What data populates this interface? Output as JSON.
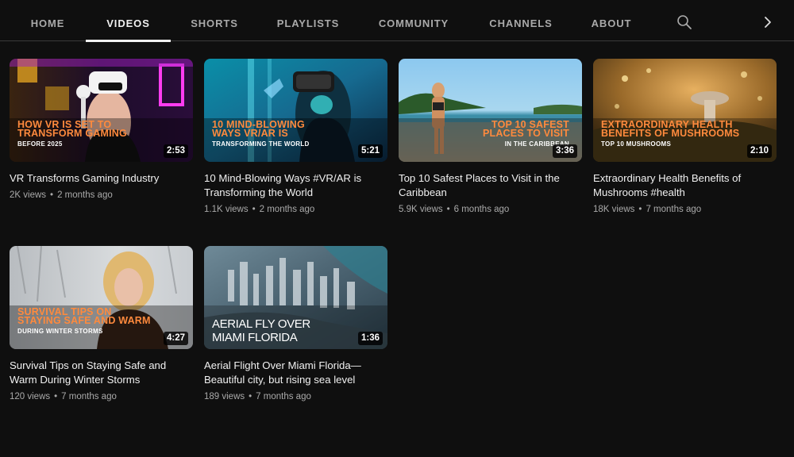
{
  "tabs": [
    {
      "label": "HOME",
      "active": false
    },
    {
      "label": "VIDEOS",
      "active": true
    },
    {
      "label": "SHORTS",
      "active": false
    },
    {
      "label": "PLAYLISTS",
      "active": false
    },
    {
      "label": "COMMUNITY",
      "active": false
    },
    {
      "label": "CHANNELS",
      "active": false
    },
    {
      "label": "ABOUT",
      "active": false
    }
  ],
  "icons": {
    "search": "search-icon",
    "next": "chevron-right-icon"
  },
  "videos": [
    {
      "title": "VR Transforms Gaming Industry",
      "views": "2K views",
      "age": "2 months ago",
      "duration": "2:53",
      "overlay": [
        "HOW VR IS SET TO",
        "TRANSFORM GAMING",
        "BEFORE 2025"
      ]
    },
    {
      "title": "10 Mind-Blowing Ways #VR/AR is Transforming the World",
      "views": "1.1K views",
      "age": "2 months ago",
      "duration": "5:21",
      "overlay": [
        "10 MIND-BLOWING",
        "WAYS VR/AR IS",
        "TRANSFORMING THE WORLD"
      ]
    },
    {
      "title": "Top 10 Safest Places to Visit in the Caribbean",
      "views": "5.9K views",
      "age": "6 months ago",
      "duration": "3:36",
      "overlay": [
        "TOP 10 SAFEST",
        "PLACES TO VISIT",
        "IN THE CARIBBEAN"
      ]
    },
    {
      "title": "Extraordinary Health Benefits of Mushrooms #health",
      "views": "18K views",
      "age": "7 months ago",
      "duration": "2:10",
      "overlay": [
        "EXTRAORDINARY HEALTH",
        "BENEFITS OF MUSHROOMS",
        "TOP 10 MUSHROOMS"
      ]
    },
    {
      "title": "Survival Tips on Staying Safe and Warm During Winter Storms",
      "views": "120 views",
      "age": "7 months ago",
      "duration": "4:27",
      "overlay": [
        "SURVIVAL TIPS ON",
        "STAYING SAFE AND WARM",
        "DURING WINTER STORMS"
      ]
    },
    {
      "title": "Aerial Flight Over Miami Florida—Beautiful city, but rising sea level",
      "views": "189 views",
      "age": "7 months ago",
      "duration": "1:36",
      "overlay": [
        "AERIAL FLY OVER",
        "MIAMI FLORIDA"
      ]
    }
  ],
  "meta_separator": "•",
  "colors": {
    "background": "#0f0f0f",
    "text_primary": "#f1f1f1",
    "text_secondary": "#aaaaaa",
    "thumb_accent": "#ff8a3d"
  }
}
